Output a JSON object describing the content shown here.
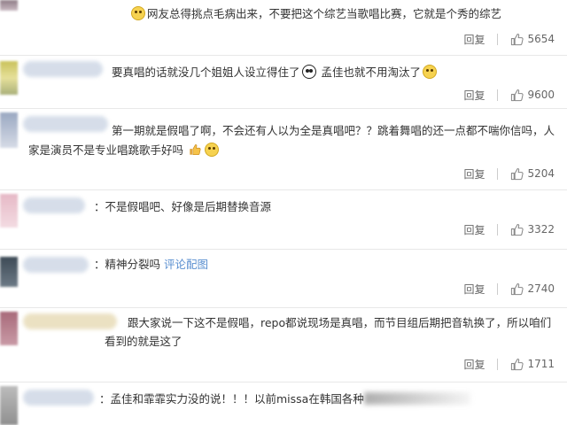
{
  "comments": [
    {
      "text": "网友总得挑点毛病出来，不要把这个综艺当歌唱比赛，它就是个秀的综艺",
      "reply_label": "回复",
      "likes": "5654",
      "leading_emoji": "doge-icon"
    },
    {
      "text_a": "要真唱的话就没几个姐姐人设立得住了",
      "text_b": "孟佳也就不用淘汰了",
      "reply_label": "回复",
      "likes": "9600",
      "emojis": [
        "scared-face-icon",
        "thinking-face-icon"
      ]
    },
    {
      "line1": "第一期就是假唱了啊，不会还有人以为全是真唱吧？？跳着舞唱的还一点都不喘你信吗，人",
      "line2": "家是演员不是专业唱跳歌手好吗",
      "reply_label": "回复",
      "likes": "5204",
      "emojis": [
        "thumbs-up-icon",
        "laughing-tears-icon"
      ]
    },
    {
      "text": "不是假唱吧、好像是后期替换音源",
      "reply_label": "回复",
      "likes": "3322"
    },
    {
      "text": "精神分裂吗",
      "link_text": "评论配图",
      "reply_label": "回复",
      "likes": "2740"
    },
    {
      "line1": "跟大家说一下这不是假唱，repo都说现场是真唱，而节目组后期把音轨换了，所以咱们",
      "line2": "看到的就是这了",
      "reply_label": "回复",
      "likes": "1711"
    },
    {
      "text": "：孟佳和霏霏实力没的说！！！以前missa在韩国各种"
    }
  ],
  "colors": {
    "text": "#333333",
    "link": "#5a8fd0",
    "meta": "#666666",
    "separator": "#e8e8e8"
  }
}
